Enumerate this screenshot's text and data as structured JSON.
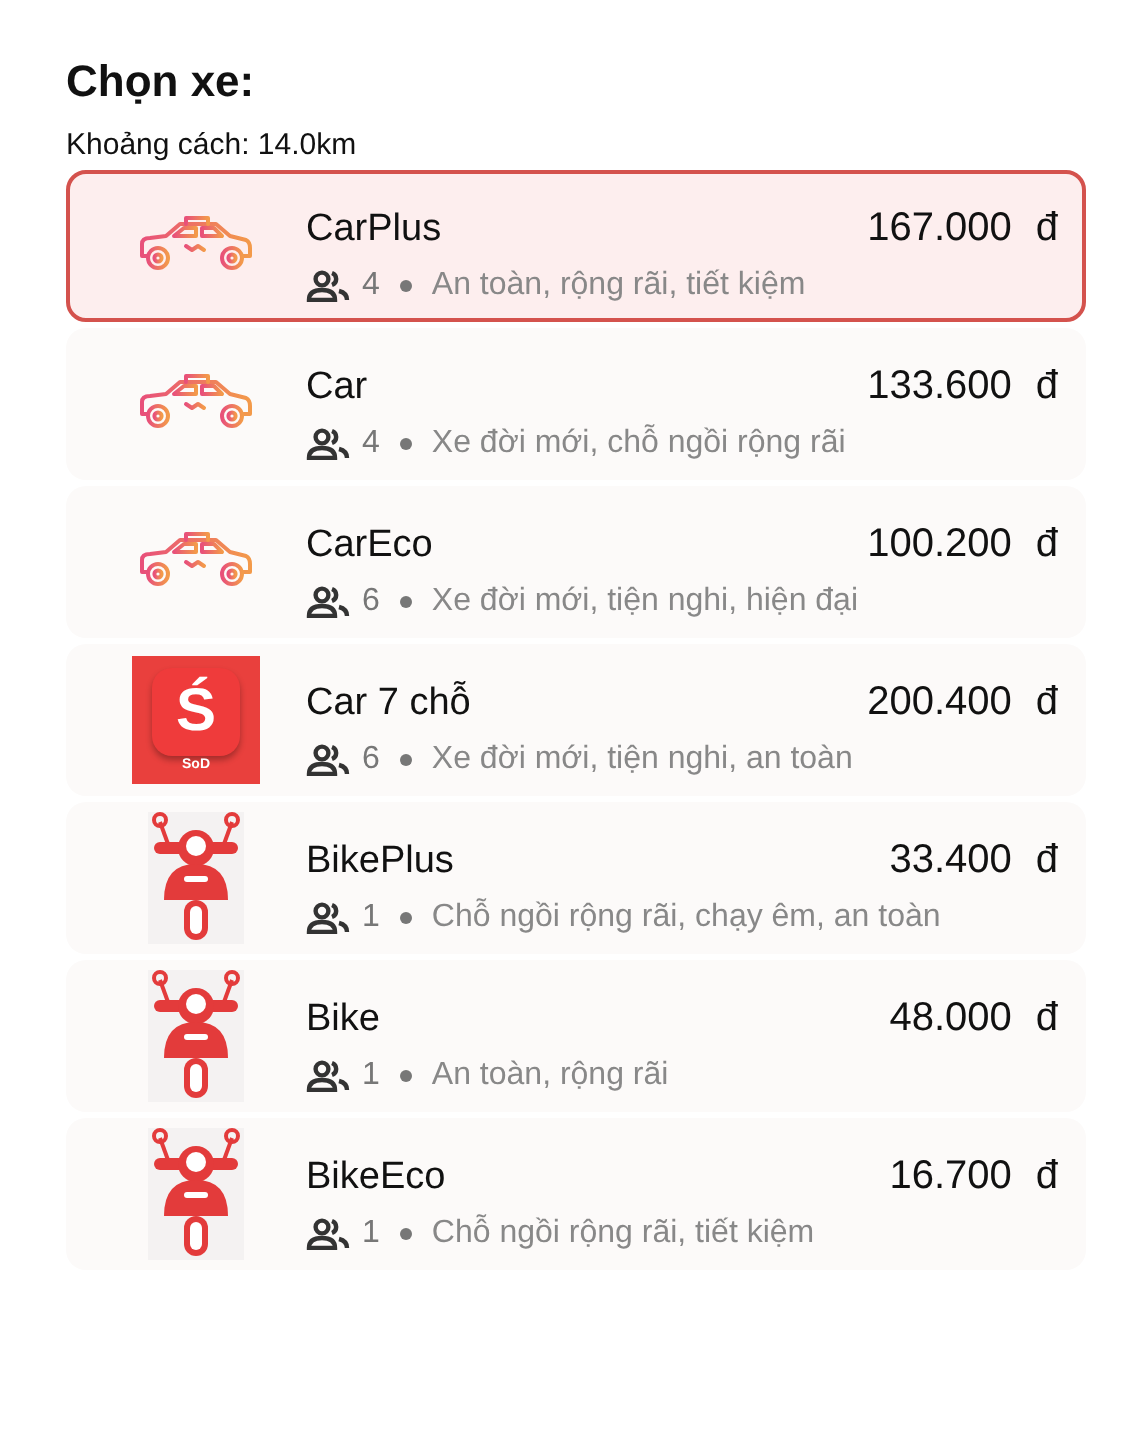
{
  "title": "Chọn xe:",
  "distance": "Khoảng cách: 14.0km",
  "options": [
    {
      "kind": "taxi",
      "name": "CarPlus",
      "seats": "4",
      "features": "An toàn, rộng rãi, tiết kiệm",
      "price": "167.000",
      "currency": "đ",
      "selected": true
    },
    {
      "kind": "taxi",
      "name": "Car",
      "seats": "4",
      "features": "Xe đời mới, chỗ ngồi rộng rãi",
      "price": "133.600",
      "currency": "đ",
      "selected": false
    },
    {
      "kind": "taxi",
      "name": "CarEco",
      "seats": "6",
      "features": "Xe đời mới, tiện nghi, hiện đại",
      "price": "100.200",
      "currency": "đ",
      "selected": false
    },
    {
      "kind": "app",
      "icon_letter": "Ś",
      "icon_caption": "SoD",
      "name": "Car 7 chỗ",
      "seats": "6",
      "features": "Xe đời mới, tiện nghi, an toàn",
      "price": "200.400",
      "currency": "đ",
      "selected": false
    },
    {
      "kind": "scooter",
      "name": "BikePlus",
      "seats": "1",
      "features": "Chỗ ngồi rộng rãi, chạy êm, an toàn",
      "price": "33.400",
      "currency": "đ",
      "selected": false
    },
    {
      "kind": "scooter",
      "name": "Bike",
      "seats": "1",
      "features": "An toàn, rộng rãi",
      "price": "48.000",
      "currency": "đ",
      "selected": false
    },
    {
      "kind": "scooter",
      "name": "BikeEco",
      "seats": "1",
      "features": "Chỗ ngồi rộng rãi, tiết kiệm",
      "price": "16.700",
      "currency": "đ",
      "selected": false
    }
  ]
}
